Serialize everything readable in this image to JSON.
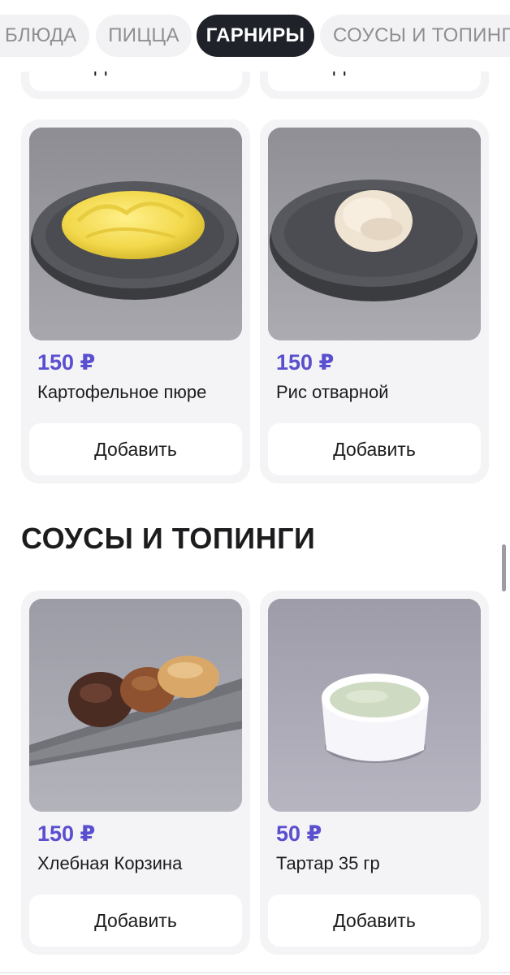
{
  "tabs": [
    {
      "label": "БЛЮДА",
      "active": false
    },
    {
      "label": "ПИЦЦА",
      "active": false
    },
    {
      "label": "ГАРНИРЫ",
      "active": true
    },
    {
      "label": "СОУСЫ И ТОПИНГИ",
      "active": false
    }
  ],
  "add_label": "Добавить",
  "garnish": {
    "items": [
      {
        "price": "150 ₽",
        "name": "Картофельное пюре",
        "image": "mashed-potatoes-photo"
      },
      {
        "price": "150 ₽",
        "name": "Рис отварной",
        "image": "boiled-rice-photo"
      }
    ]
  },
  "sauces": {
    "title": "СОУСЫ И ТОПИНГИ",
    "items": [
      {
        "price": "150 ₽",
        "name": "Хлебная Корзина",
        "image": "bread-basket-photo"
      },
      {
        "price": "50 ₽",
        "name": "Тартар 35 гр",
        "image": "tartar-sauce-photo"
      }
    ]
  },
  "colors": {
    "accent_price": "#5a4fcf",
    "active_tab": "#1f2229",
    "card_bg": "#f4f4f6"
  }
}
